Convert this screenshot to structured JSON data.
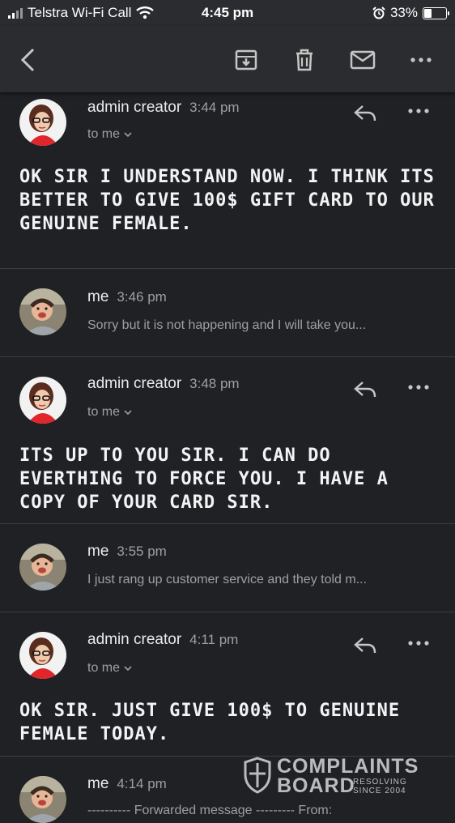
{
  "status_bar": {
    "carrier": "Telstra Wi-Fi Call",
    "time": "4:45 pm",
    "battery": "33%",
    "battery_level": 0.33
  },
  "toolbar": {
    "back_icon": "back-arrow-icon",
    "archive_icon": "archive-icon",
    "delete_icon": "trash-icon",
    "mark_icon": "mail-icon",
    "more_icon": "more-horizontal-icon"
  },
  "messages": [
    {
      "sender": "admin creator",
      "time": "3:44 pm",
      "to": "to me",
      "body": "OK SIR I UNDERSTAND NOW. I THINK ITS BETTER TO GIVE 100$ GIFT CARD TO OUR GENUINE FEMALE."
    },
    {
      "sender": "me",
      "time": "3:46 pm",
      "snippet": "Sorry but it is not happening and I will take you..."
    },
    {
      "sender": "admin creator",
      "time": "3:48 pm",
      "to": "to me",
      "body": "ITS UP TO YOU SIR. I CAN DO EVERTHING TO FORCE YOU. I HAVE A COPY OF YOUR CARD SIR."
    },
    {
      "sender": "me",
      "time": "3:55 pm",
      "snippet": "I just rang up customer service and they told m..."
    },
    {
      "sender": "admin creator",
      "time": "4:11 pm",
      "to": "to me",
      "body": "OK SIR. JUST GIVE 100$ TO GENUINE FEMALE TODAY."
    },
    {
      "sender": "me",
      "time": "4:14 pm",
      "snippet": "---------- Forwarded message --------- From:"
    }
  ],
  "watermark": {
    "line1": "COMPLAINTS",
    "line2": "BOARD",
    "tag1": "RESOLVING",
    "tag2": "SINCE 2004"
  },
  "colors": {
    "background": "#202124",
    "bar": "#2b2c2f",
    "text": "#e8eaed",
    "muted": "#9aa0a6"
  }
}
